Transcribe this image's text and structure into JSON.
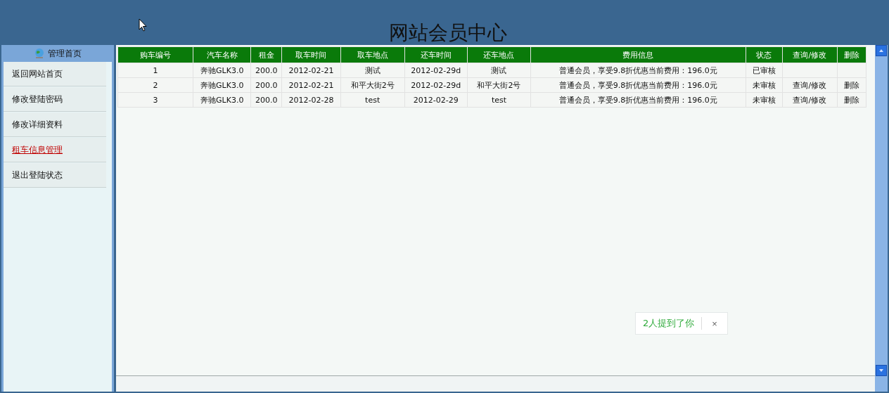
{
  "header": {
    "title": "网站会员中心"
  },
  "sidebar": {
    "title": "管理首页",
    "items": [
      {
        "label": "返回网站首页",
        "selected": false
      },
      {
        "label": "修改登陆密码",
        "selected": false
      },
      {
        "label": "修改详细资料",
        "selected": false
      },
      {
        "label": "租车信息管理",
        "selected": true
      },
      {
        "label": "退出登陆状态",
        "selected": false
      }
    ]
  },
  "table": {
    "columns": [
      "购车编号",
      "汽车名称",
      "租金",
      "取车时间",
      "取车地点",
      "还车时间",
      "还车地点",
      "费用信息",
      "状态",
      "查询/修改",
      "删除"
    ],
    "rows": [
      {
        "id": "1",
        "car": "奔驰GLK3.0",
        "rent": "200.0",
        "pickup_time": "2012-02-21",
        "pickup_place": "测试",
        "return_time": "2012-02-29d",
        "return_place": "测试",
        "fee": "普通会员，享受9.8折优惠当前费用：196.0元",
        "status": "已审核"
      },
      {
        "id": "2",
        "car": "奔驰GLK3.0",
        "rent": "200.0",
        "pickup_time": "2012-02-21",
        "pickup_place": "和平大街2号",
        "return_time": "2012-02-29d",
        "return_place": "和平大街2号",
        "fee": "普通会员，享受9.8折优惠当前费用：196.0元",
        "status": "未审核",
        "edit": "查询/修改",
        "delete": "删除"
      },
      {
        "id": "3",
        "car": "奔驰GLK3.0",
        "rent": "200.0",
        "pickup_time": "2012-02-28",
        "pickup_place": "test",
        "return_time": "2012-02-29",
        "return_place": "test",
        "fee": "普通会员，享受9.8折优惠当前费用：196.0元",
        "status": "未审核",
        "edit": "查询/修改",
        "delete": "删除"
      }
    ]
  },
  "toast": {
    "text": "2人提到了你",
    "close": "×"
  }
}
